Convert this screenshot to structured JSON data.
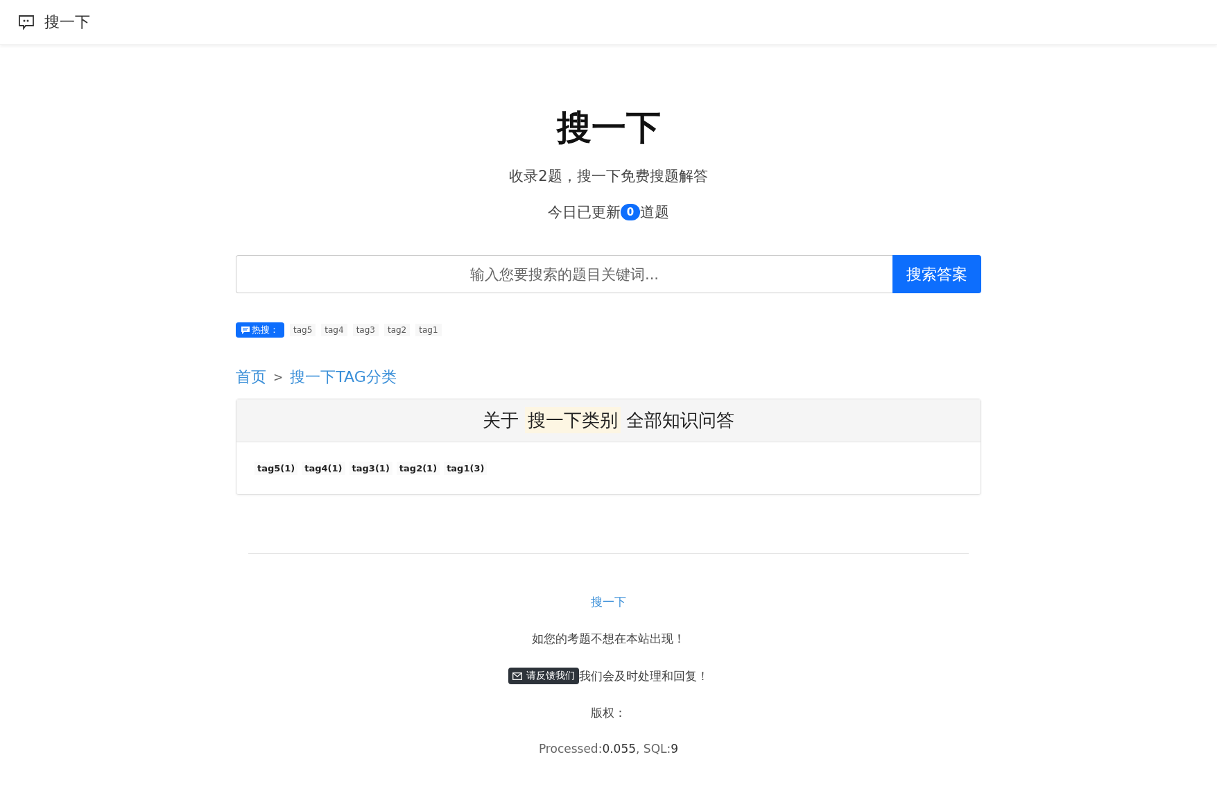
{
  "navbar": {
    "brand": "搜一下"
  },
  "hero": {
    "title": "搜一下",
    "subtitle": "收录2题，搜一下免费搜题解答",
    "update_prefix": "今日已更新",
    "update_count": "0",
    "update_suffix": "道题"
  },
  "search": {
    "placeholder": "输入您要搜索的题目关键词...",
    "button": "搜索答案"
  },
  "hot": {
    "label": "热搜：",
    "tags": [
      "tag5",
      "tag4",
      "tag3",
      "tag2",
      "tag1"
    ]
  },
  "breadcrumb": {
    "items": [
      "首页",
      "搜一下TAG分类"
    ],
    "separator": ">"
  },
  "card": {
    "title_prefix": "关于",
    "title_highlight": "搜一下类别",
    "title_suffix": "全部知识问答",
    "tags": [
      "tag5(1)",
      "tag4(1)",
      "tag3(1)",
      "tag2(1)",
      "tag1(3)"
    ]
  },
  "footer": {
    "link": "搜一下",
    "notice": "如您的考题不想在本站出现！",
    "feedback_button": "请反馈我们",
    "feedback_text": "我们会及时处理和回复！",
    "copyright": "版权：",
    "stats": "Processed:**0.055**, SQL:**9**"
  }
}
